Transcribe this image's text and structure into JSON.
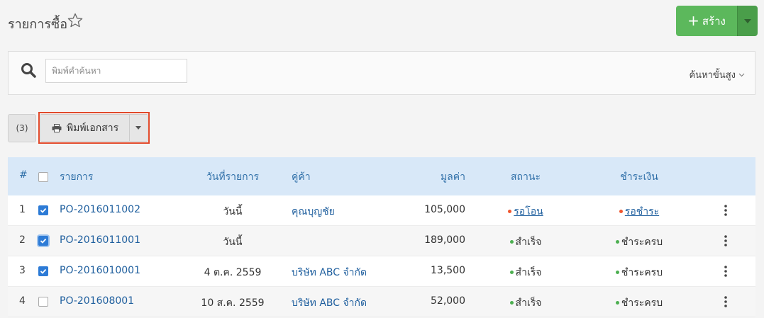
{
  "header": {
    "title": "รายการซื้อ",
    "create_label": "สร้าง",
    "create_plus": "+"
  },
  "search": {
    "placeholder": "พิมพ์คำค้นหา",
    "advanced_label": "ค้นหาขั้นสูง"
  },
  "toolbar": {
    "selected_count": "(3)",
    "print_label": "พิมพ์เอกสาร"
  },
  "table": {
    "columns": {
      "num": "#",
      "doc": "รายการ",
      "date": "วันที่รายการ",
      "vendor": "คู่ค้า",
      "amount": "มูลค่า",
      "status": "สถานะ",
      "payment": "ชำระเงิน"
    },
    "rows": [
      {
        "num": "1",
        "checked": true,
        "doc": "PO-2016011002",
        "date": "วันนี้",
        "vendor": "คุณบุญชัย",
        "amount": "105,000",
        "status": "รอโอน",
        "payment": "รอชำระ"
      },
      {
        "num": "2",
        "checked": true,
        "doc": "PO-2016011001",
        "date": "วันนี้",
        "vendor": "",
        "amount": "189,000",
        "status": "สำเร็จ",
        "payment": "ชำระครบ"
      },
      {
        "num": "3",
        "checked": true,
        "doc": "PO-2016010001",
        "date": "4 ต.ค. 2559",
        "vendor": "บริษัท ABC จำกัด",
        "amount": "13,500",
        "status": "สำเร็จ",
        "payment": "ชำระครบ"
      },
      {
        "num": "4",
        "checked": false,
        "doc": "PO-201608001",
        "date": "10 ส.ค. 2559",
        "vendor": "บริษัท ABC จำกัด",
        "amount": "52,000",
        "status": "สำเร็จ",
        "payment": "ชำระครบ"
      }
    ]
  },
  "colors": {
    "accent_green": "#5cb85c",
    "link_blue": "#1f5f9e",
    "header_blue": "#d8e8f8",
    "highlight_red": "#e0492a",
    "status_green": "#4caf50",
    "status_orange": "#f0562e"
  }
}
